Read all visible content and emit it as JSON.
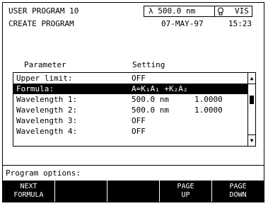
{
  "header": {
    "program": "USER PROGRAM 10",
    "mode": "CREATE PROGRAM",
    "wavelength": "λ 500.0 nm",
    "source": "VIS",
    "date": "07-MAY-97",
    "time": "15:23"
  },
  "table": {
    "col_param": "Parameter",
    "col_setting": "Setting",
    "rows": [
      {
        "param": "Upper limit:",
        "setting": "OFF",
        "extra": ""
      },
      {
        "param": "Formula:",
        "setting": "A=K₁A₁ +K₂A₂",
        "extra": ""
      },
      {
        "param": "Wavelength 1:",
        "setting": "500.0 nm",
        "extra": "1.0000"
      },
      {
        "param": "Wavelength 2:",
        "setting": "500.0 nm",
        "extra": "1.0000"
      },
      {
        "param": "Wavelength 3:",
        "setting": "OFF",
        "extra": ""
      },
      {
        "param": "Wavelength 4:",
        "setting": "OFF",
        "extra": ""
      }
    ],
    "selected_row": 1
  },
  "prompt": "Program options:",
  "softkeys": [
    {
      "line1": "NEXT",
      "line2": "FORMULA"
    },
    {
      "line1": "",
      "line2": ""
    },
    {
      "line1": "",
      "line2": ""
    },
    {
      "line1": "PAGE",
      "line2": "UP"
    },
    {
      "line1": "PAGE",
      "line2": "DOWN"
    }
  ]
}
